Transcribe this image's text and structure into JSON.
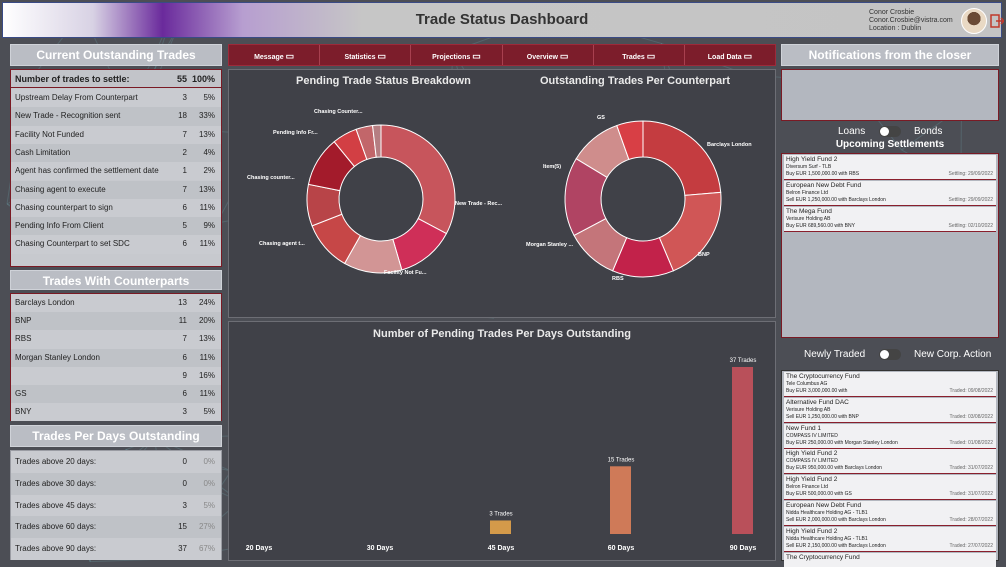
{
  "header": {
    "title": "Trade Status Dashboard",
    "user_name": "Conor Crosbie",
    "user_email": "Conor.Crosbie@vistra.com",
    "user_location": "Location : Dublin"
  },
  "outstanding": {
    "title": "Current Outstanding Trades",
    "summary_label": "Number of trades to settle:",
    "summary_count": "55",
    "summary_pct": "100%",
    "rows": [
      {
        "label": "Upstream Delay From Counterpart",
        "count": "3",
        "pct": "5%"
      },
      {
        "label": "New Trade - Recognition sent",
        "count": "18",
        "pct": "33%"
      },
      {
        "label": "Facility Not Funded",
        "count": "7",
        "pct": "13%"
      },
      {
        "label": "Cash Limitation",
        "count": "2",
        "pct": "4%"
      },
      {
        "label": "Agent has confirmed the settlement date",
        "count": "1",
        "pct": "2%"
      },
      {
        "label": "Chasing agent to execute",
        "count": "7",
        "pct": "13%"
      },
      {
        "label": "Chasing counterpart to sign",
        "count": "6",
        "pct": "11%"
      },
      {
        "label": "Pending Info From Client",
        "count": "5",
        "pct": "9%"
      },
      {
        "label": "Chasing Counterpart to set SDC",
        "count": "6",
        "pct": "11%"
      }
    ]
  },
  "counterparts": {
    "title": "Trades With Counterparts",
    "rows": [
      {
        "label": "Barclays London",
        "count": "13",
        "pct": "24%"
      },
      {
        "label": "BNP",
        "count": "11",
        "pct": "20%"
      },
      {
        "label": "RBS",
        "count": "7",
        "pct": "13%"
      },
      {
        "label": "Morgan Stanley London",
        "count": "6",
        "pct": "11%"
      },
      {
        "label": "",
        "count": "9",
        "pct": "16%"
      },
      {
        "label": "GS",
        "count": "6",
        "pct": "11%"
      },
      {
        "label": "BNY",
        "count": "3",
        "pct": "5%"
      }
    ]
  },
  "days": {
    "title": "Trades Per Days Outstanding",
    "rows": [
      {
        "label": "Trades above 20 days:",
        "count": "0",
        "pct": "0%"
      },
      {
        "label": "Trades above 30 days:",
        "count": "0",
        "pct": "0%"
      },
      {
        "label": "Trades above 45 days:",
        "count": "3",
        "pct": "5%"
      },
      {
        "label": "Trades above 60 days:",
        "count": "15",
        "pct": "27%"
      },
      {
        "label": "Trades above 90 days:",
        "count": "37",
        "pct": "67%"
      }
    ]
  },
  "nav": [
    {
      "label": "Message",
      "icon": "message-icon"
    },
    {
      "label": "Statistics",
      "icon": "bar-chart-icon"
    },
    {
      "label": "Projections",
      "icon": "calculator-icon"
    },
    {
      "label": "Overview",
      "icon": "folder-icon"
    },
    {
      "label": "Trades",
      "icon": "list-icon"
    },
    {
      "label": "Load Data",
      "icon": "pie-icon"
    }
  ],
  "chart_data": [
    {
      "type": "pie",
      "title": "Pending Trade Status Breakdown",
      "categories": [
        "New Trade - Rec...",
        "Facility Not Fu...",
        "Chasing agent t...",
        "Chasing counter...",
        "Pending Info Fr...",
        "Chasing Counter..."
      ],
      "labels_shown": true,
      "values": [
        18,
        7,
        7,
        6,
        5,
        6,
        3,
        2,
        1
      ]
    },
    {
      "type": "pie",
      "title": "Outstanding Trades Per Counterpart",
      "categories": [
        "Barclays London",
        "BNP",
        "RBS",
        "Morgan Stanley ...",
        "Item(5)",
        "GS"
      ],
      "values": [
        13,
        11,
        7,
        6,
        9,
        6,
        3
      ]
    },
    {
      "type": "bar",
      "title": "Number of Pending Trades Per Days Outstanding",
      "categories": [
        "20 Days",
        "30 Days",
        "45 Days",
        "60 Days",
        "90 Days"
      ],
      "values": [
        0,
        0,
        3,
        15,
        37
      ],
      "data_labels": [
        "",
        "",
        "3 Trades",
        "15 Trades",
        "37 Trades"
      ],
      "colors": [
        "#d49a4a",
        "#d49a4a",
        "#d49a4a",
        "#cf7a58",
        "#b9505a"
      ]
    }
  ],
  "notifications": {
    "title": "Notifications from the closer",
    "toggle_left": "Loans",
    "toggle_right": "Bonds",
    "upcoming_title": "Upcoming Settlements",
    "upcoming": [
      {
        "fund": "High Yield Fund 2",
        "company": "Diversum Surf - TLB",
        "detail": "Buy EUR  1,500,000.00  with RBS",
        "date": "Settling: 29/09/2022"
      },
      {
        "fund": "European New Debt Fund",
        "company": "Belron Finance Ltd",
        "detail": "Sell EUR  1,250,000.00  with Barclays London",
        "date": "Settling: 29/09/2022"
      },
      {
        "fund": "The Mega Fund",
        "company": "Verisure Holding AB",
        "detail": "Buy EUR  689,560.00  with BNY",
        "date": "Settling: 02/10/2022"
      }
    ],
    "toggle2_left": "Newly Traded",
    "toggle2_right": "New Corp. Action",
    "traded": [
      {
        "fund": "The Cryptocurrency Fund",
        "company": "Tele Columbus AG",
        "detail": "Buy EUR  3,000,000.00  with",
        "date": "Traded: 09/08/2022"
      },
      {
        "fund": "Alternative Fund DAC",
        "company": "Verisure Holding AB",
        "detail": "Sell EUR  1,250,000.00  with BNP",
        "date": "Traded: 03/08/2022"
      },
      {
        "fund": "New Fund 1",
        "company": "COMPASS IV LIMITED",
        "detail": "Buy EUR  250,000.00  with Morgan Stanley London",
        "date": "Traded: 01/08/2022"
      },
      {
        "fund": "High Yield Fund 2",
        "company": "COMPASS IV LIMITED",
        "detail": "Buy EUR  950,000.00  with Barclays London",
        "date": "Traded: 31/07/2022"
      },
      {
        "fund": "High Yield Fund 2",
        "company": "Belron Finance Ltd",
        "detail": "Buy EUR  500,000.00  with GS",
        "date": "Traded: 31/07/2022"
      },
      {
        "fund": "European New Debt Fund",
        "company": "Nidda Healthcare Holding AG - TLB1",
        "detail": "Sell EUR  2,000,000.00  with Barclays London",
        "date": "Traded: 28/07/2022"
      },
      {
        "fund": "High Yield Fund 2",
        "company": "Nidda Healthcare Holding AG - TLB1",
        "detail": "Sell EUR  2,150,000.00  with Barclays London",
        "date": "Traded: 27/07/2022"
      },
      {
        "fund": "The Cryptocurrency Fund",
        "company": "",
        "detail": "",
        "date": ""
      }
    ]
  }
}
